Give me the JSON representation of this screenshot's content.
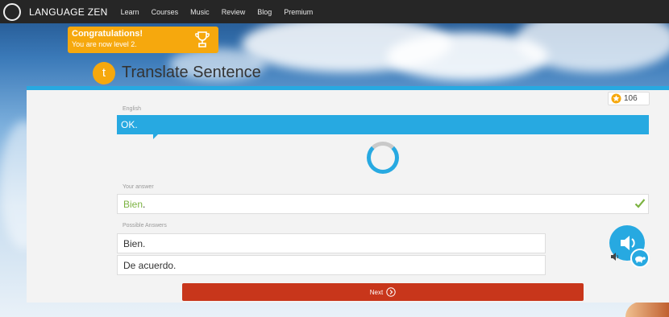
{
  "nav": {
    "brand": "LANGUAGE ZEN",
    "links": [
      "Learn",
      "Courses",
      "Music",
      "Review",
      "Blog",
      "Premium"
    ]
  },
  "congrats": {
    "title": "Congratulations!",
    "subtitle": "You are now level 2.",
    "icon": "trophy-icon"
  },
  "lesson": {
    "badge": "t",
    "title": "Translate Sentence"
  },
  "score": {
    "value": "106",
    "icon": "star-icon"
  },
  "prompt": {
    "language_label": "English",
    "text": "OK."
  },
  "answer": {
    "label": "Your answer",
    "word": "Bien",
    "punct": ".",
    "status_icon": "check-icon",
    "status_color": "#7cb342"
  },
  "possible": {
    "label": "Possible Answers",
    "options": [
      "Bien.",
      "De acuerdo."
    ]
  },
  "next": {
    "label": "Next"
  },
  "colors": {
    "accent": "#27a9e1",
    "congrats": "#f6a80d",
    "next": "#c8361b"
  }
}
